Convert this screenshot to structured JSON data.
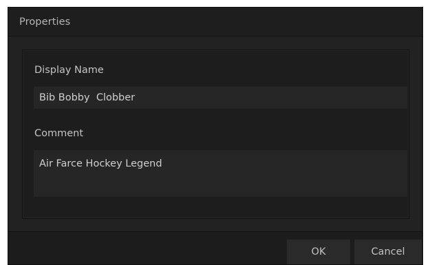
{
  "dialog": {
    "title": "Properties"
  },
  "form": {
    "display_name_label": "Display Name",
    "display_name_value": "Bib Bobby  Clobber",
    "comment_label": "Comment",
    "comment_value": "Air Farce Hockey Legend"
  },
  "footer": {
    "ok_label": "OK",
    "cancel_label": "Cancel"
  },
  "colors": {
    "dialog_background": "#1e1e1e",
    "field_background": "#262626",
    "button_background": "#2a2a2a",
    "text": "#c4c4c4"
  }
}
